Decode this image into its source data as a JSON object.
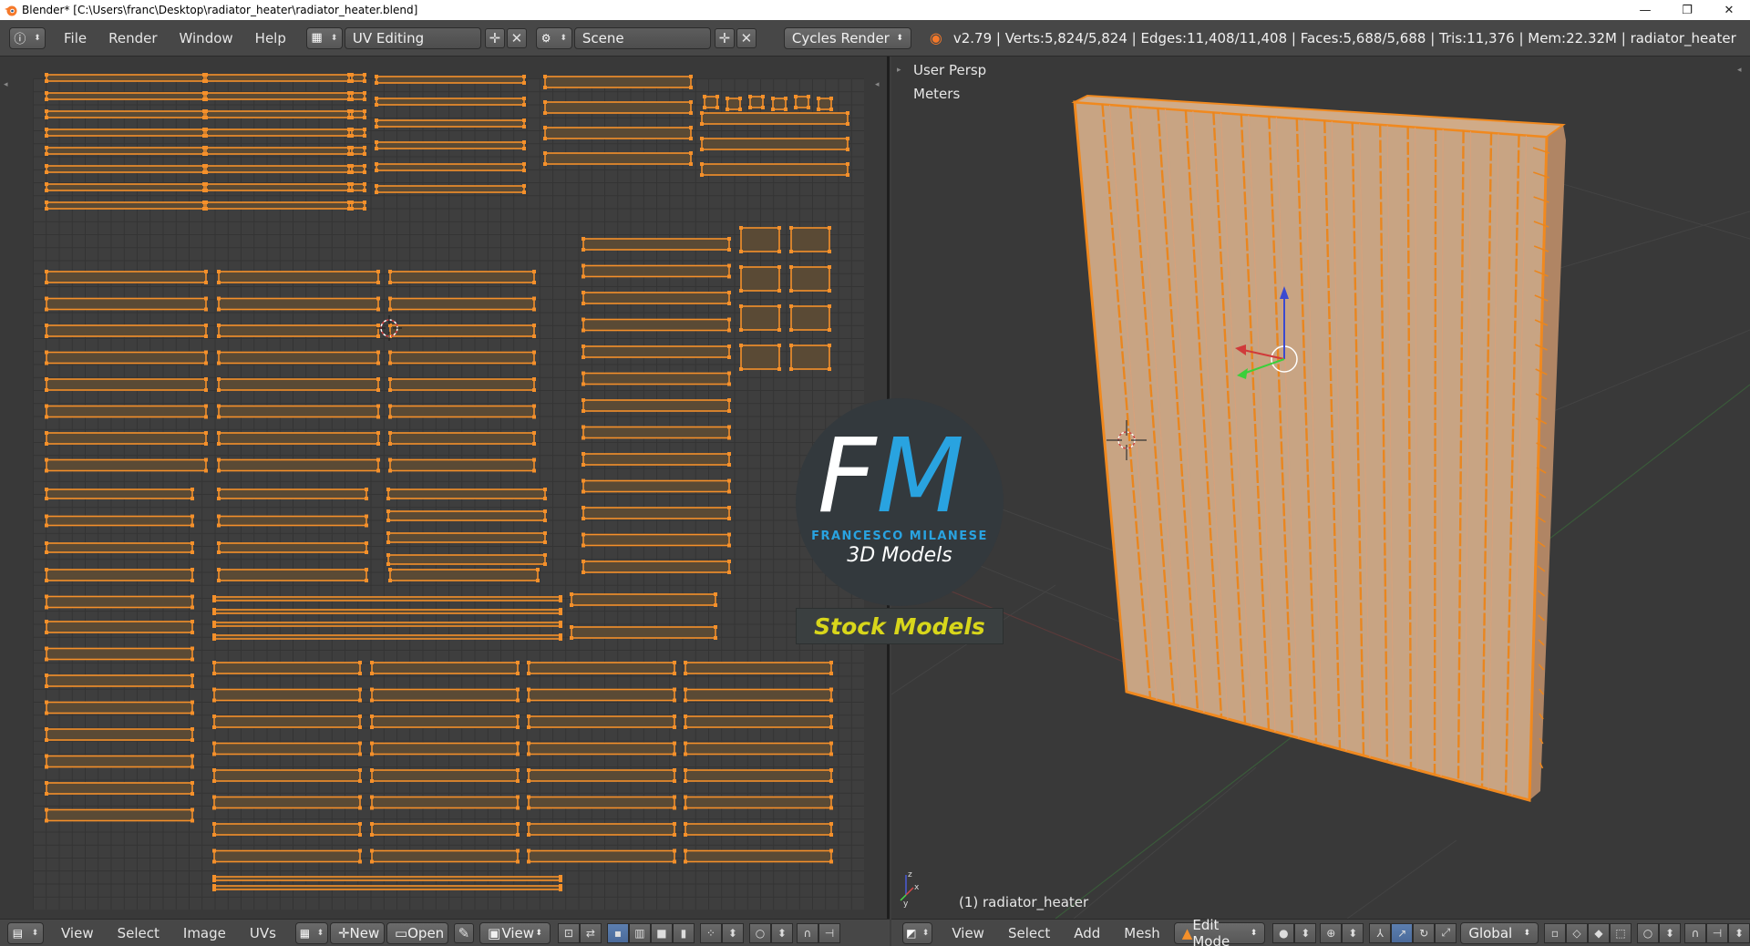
{
  "titlebar": {
    "title": "Blender* [C:\\Users\\franc\\Desktop\\radiator_heater\\radiator_heater.blend]",
    "minimize": "—",
    "restore": "❐",
    "close": "✕"
  },
  "info_header": {
    "menus": [
      "File",
      "Render",
      "Window",
      "Help"
    ],
    "screen_layout": "UV Editing",
    "scene": "Scene",
    "render_engine": "Cycles Render",
    "stats": "v2.79 | Verts:5,824/5,824 | Edges:11,408/11,408 | Faces:5,688/5,688 | Tris:11,376 | Mem:22.32M | radiator_heater"
  },
  "uv_footer": {
    "menus": [
      "View",
      "Select",
      "Image",
      "UVs"
    ],
    "new_label": "New",
    "open_label": "Open",
    "view_label": "View"
  },
  "viewport": {
    "view_name": "User Persp",
    "units": "Meters",
    "object_label": "(1) radiator_heater"
  },
  "vp_footer": {
    "menus": [
      "View",
      "Select",
      "Add",
      "Mesh"
    ],
    "mode": "Edit Mode",
    "orientation": "Global"
  },
  "watermark": {
    "fm_f": "F",
    "fm_m": "M",
    "name": "FRANCESCO MILANESE",
    "subtitle": "3D Models",
    "badge": "Stock Models"
  },
  "colors": {
    "uv_orange": "#f5902a",
    "uv_fill": "#5a4a35",
    "mesh_fill": "#c8a483",
    "mesh_edge": "#e9861f",
    "selected_orange": "#ffa533",
    "accent_blue": "#29a3e0",
    "badge_yellow": "#d8d61b"
  },
  "icons": [
    "blender-logo-icon",
    "info-icon",
    "layout-icon",
    "scene-icon",
    "render-icon",
    "add-icon",
    "close-icon"
  ]
}
